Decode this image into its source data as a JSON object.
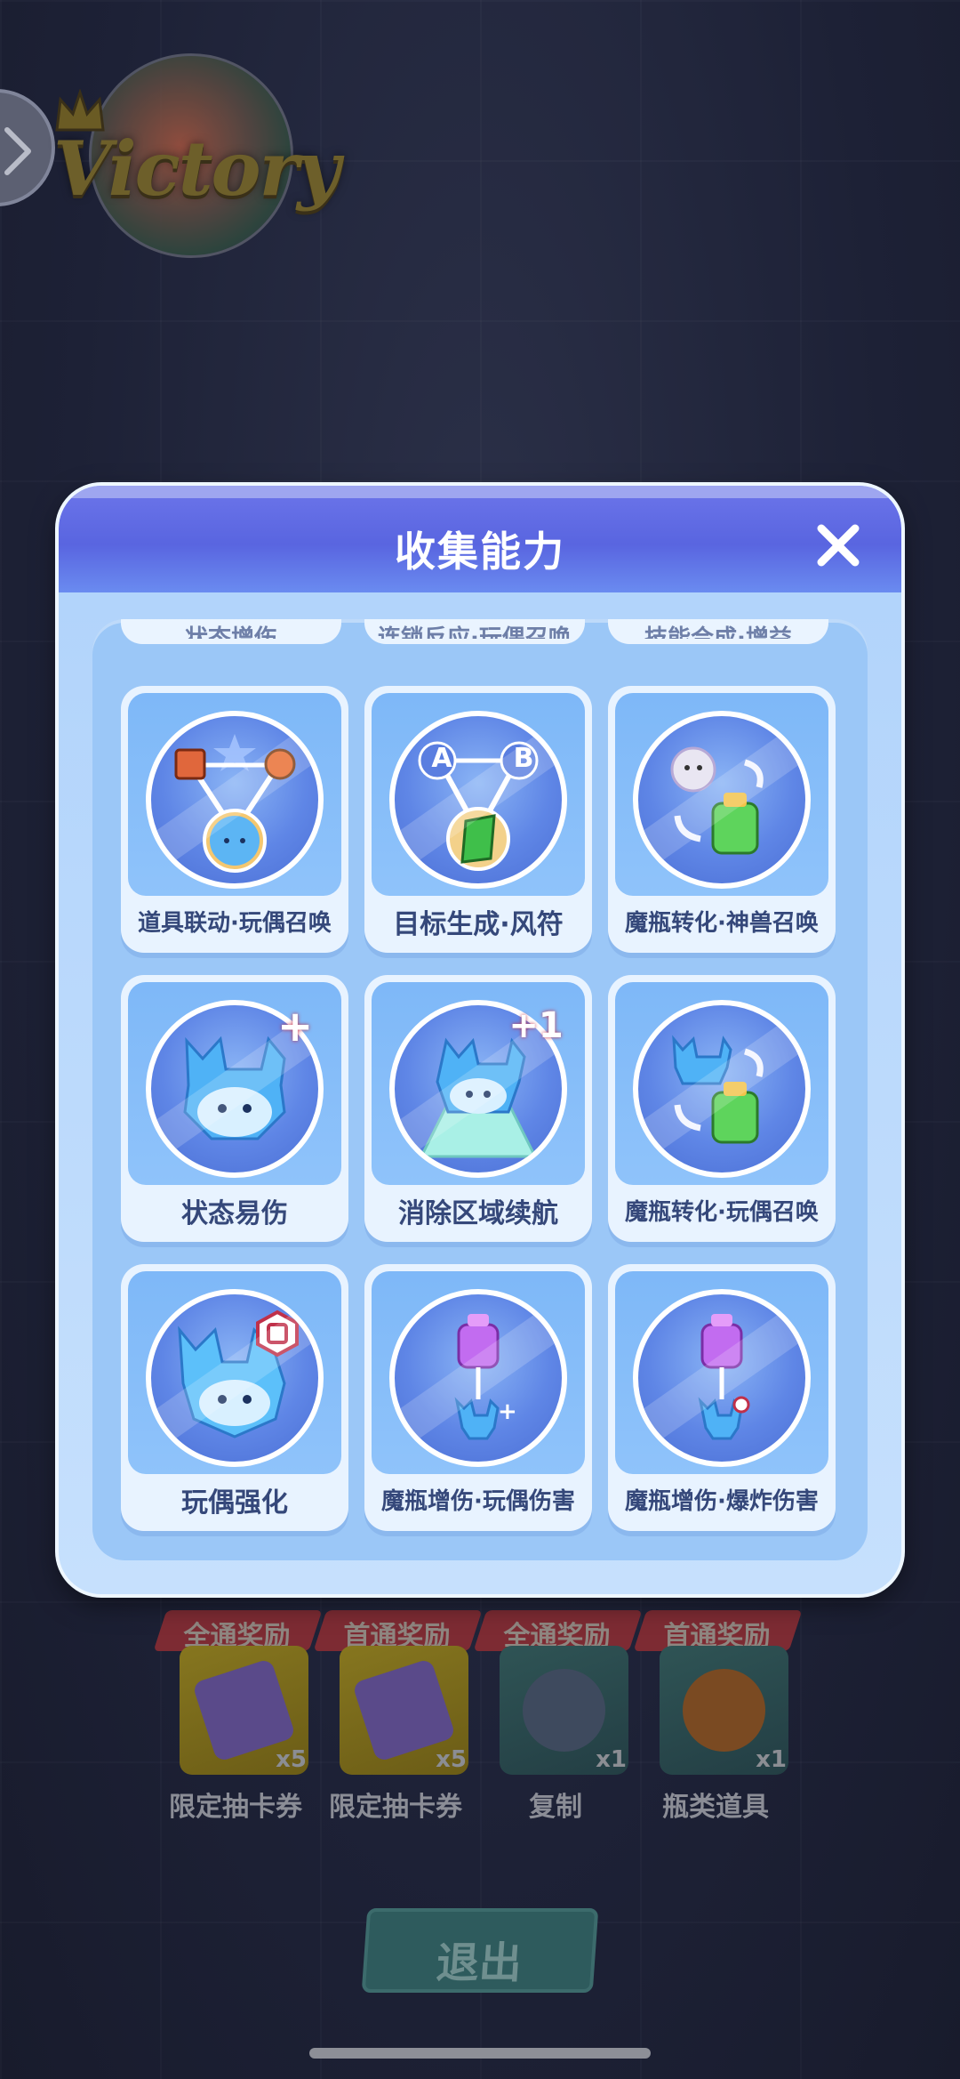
{
  "background": {
    "victory_text": "Victory",
    "rewards": [
      {
        "tag": "全通奖励",
        "name": "限定抽卡券",
        "count": "x5",
        "style": "gold"
      },
      {
        "tag": "首通奖励",
        "name": "限定抽卡券",
        "count": "x5",
        "style": "gold"
      },
      {
        "tag": "全通奖励",
        "name": "复制",
        "count": "x1",
        "style": "teal"
      },
      {
        "tag": "首通奖励",
        "name": "瓶类道具",
        "count": "x1",
        "style": "teal"
      }
    ],
    "exit_label": "退出"
  },
  "modal": {
    "title": "收集能力",
    "close_icon": "close-icon",
    "peek_labels": [
      "状态增伤",
      "连锁反应·玩偶召唤",
      "技能合成·增益"
    ],
    "cards": [
      {
        "label": "道具联动·玩偶召唤",
        "icon": "item-link-doll-icon",
        "big": false
      },
      {
        "label": "目标生成·风符",
        "icon": "wind-talisman-icon",
        "big": true
      },
      {
        "label": "魔瓶转化·神兽召唤",
        "icon": "bottle-beast-icon",
        "big": false
      },
      {
        "label": "状态易伤",
        "icon": "doll-plus-icon",
        "big": true
      },
      {
        "label": "消除区域续航",
        "icon": "doll-plus-one-icon",
        "big": true
      },
      {
        "label": "魔瓶转化·玩偶召唤",
        "icon": "bottle-doll-icon",
        "big": false
      },
      {
        "label": "玩偶强化",
        "icon": "doll-fist-icon",
        "big": true
      },
      {
        "label": "魔瓶增伤·玩偶伤害",
        "icon": "bottle-doll-damage-icon",
        "big": false
      },
      {
        "label": "魔瓶增伤·爆炸伤害",
        "icon": "bottle-explosion-icon",
        "big": false
      }
    ],
    "badges": {
      "ab_left": "A",
      "ab_right": "B",
      "plus_one": "+1",
      "plus": "+"
    }
  },
  "colors": {
    "header": "#5965e0",
    "panel": "#9bc7f7",
    "card": "#e8f3ff",
    "label": "#35487a"
  }
}
